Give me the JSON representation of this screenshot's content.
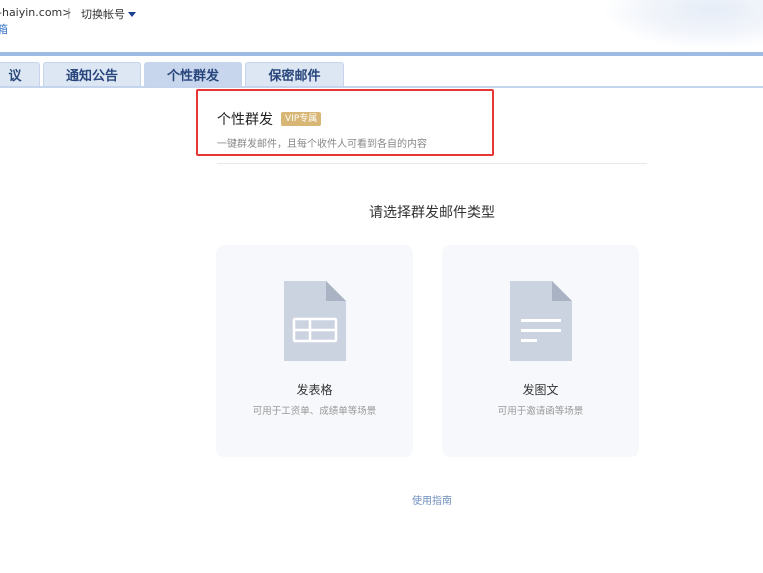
{
  "header": {
    "account_email": "-haiyin.com>",
    "separator": "|",
    "switch_account": "切换帐号",
    "fragment_text": "箱"
  },
  "tabs": [
    {
      "label": "议",
      "active": false
    },
    {
      "label": "通知公告",
      "active": false
    },
    {
      "label": "个性群发",
      "active": true
    },
    {
      "label": "保密邮件",
      "active": false
    }
  ],
  "panel": {
    "title": "个性群发",
    "vip_badge": "VIP专属",
    "subtitle": "一键群发邮件，且每个收件人可看到各自的内容",
    "prompt": "请选择群发邮件类型",
    "cards": [
      {
        "title": "发表格",
        "desc": "可用于工资单、成绩单等场景",
        "icon": "spreadsheet-document-icon"
      },
      {
        "title": "发图文",
        "desc": "可用于邀请函等场景",
        "icon": "text-document-icon"
      }
    ],
    "guide_link": "使用指南"
  },
  "colors": {
    "tab_text": "#29467c",
    "tab_bg": "#dde7f4",
    "tab_active_bg": "#c7d6ec",
    "highlight_border": "#e63636",
    "vip_badge_bg": "#d7b676",
    "card_bg": "#f6f8fb",
    "icon_fill": "#ccd3e0"
  }
}
